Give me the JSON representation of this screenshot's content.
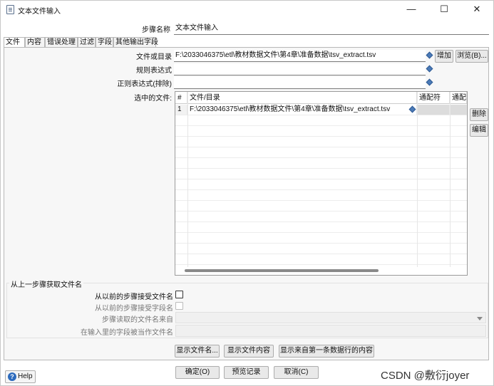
{
  "window": {
    "title": "文本文件输入",
    "minimize_glyph": "—",
    "maximize_glyph": "☐",
    "close_glyph": "✕"
  },
  "step_name": {
    "label": "步骤名称",
    "value": "文本文件输入"
  },
  "tabs": [
    {
      "label": "文件",
      "active": true
    },
    {
      "label": "内容",
      "active": false
    },
    {
      "label": "错误处理",
      "active": false
    },
    {
      "label": "过滤",
      "active": false
    },
    {
      "label": "字段",
      "active": false
    },
    {
      "label": "其他输出字段",
      "active": false
    }
  ],
  "file_tab": {
    "file_or_dir_label": "文件或目录",
    "file_or_dir_value": "F:\\2033046375\\etl\\教材数据文件\\第4章\\准备数据\\tsv_extract.tsv",
    "add_button": "增加",
    "browse_button": "浏览(B)...",
    "regex_label": "规则表达式",
    "regex_value": "",
    "exclude_regex_label": "正则表达式(排除)",
    "exclude_regex_value": "",
    "selected_files_label": "选中的文件:",
    "delete_button": "删除",
    "edit_button": "编辑",
    "grid": {
      "columns": [
        "#",
        "文件/目录",
        "通配符",
        "通配"
      ],
      "rows": [
        {
          "num": "1",
          "path": "F:\\2033046375\\etl\\教材数据文件\\第4章\\准备数据\\tsv_extract.tsv",
          "wildcard": "",
          "wildcard2": ""
        }
      ]
    }
  },
  "prev_step_group": {
    "title": "从上一步骤获取文件名",
    "accept_filenames_label": "从以前的步骤接受文件名",
    "accept_filenames_checked": false,
    "accept_fields_label": "从以前的步骤接受字段名",
    "read_from_label": "步骤读取的文件名来自",
    "read_from_value": "",
    "field_as_filename_label": "在输入里的字段被当作文件名",
    "field_as_filename_value": ""
  },
  "action_buttons": {
    "show_filenames": "显示文件名...",
    "show_file_content": "显示文件内容",
    "show_first_row_content": "显示来自第一条数据行的内容"
  },
  "footer": {
    "help": "Help",
    "ok": "确定(O)",
    "preview": "预览记录",
    "cancel": "取消(C)"
  },
  "watermark": "CSDN @敷衍joyer"
}
